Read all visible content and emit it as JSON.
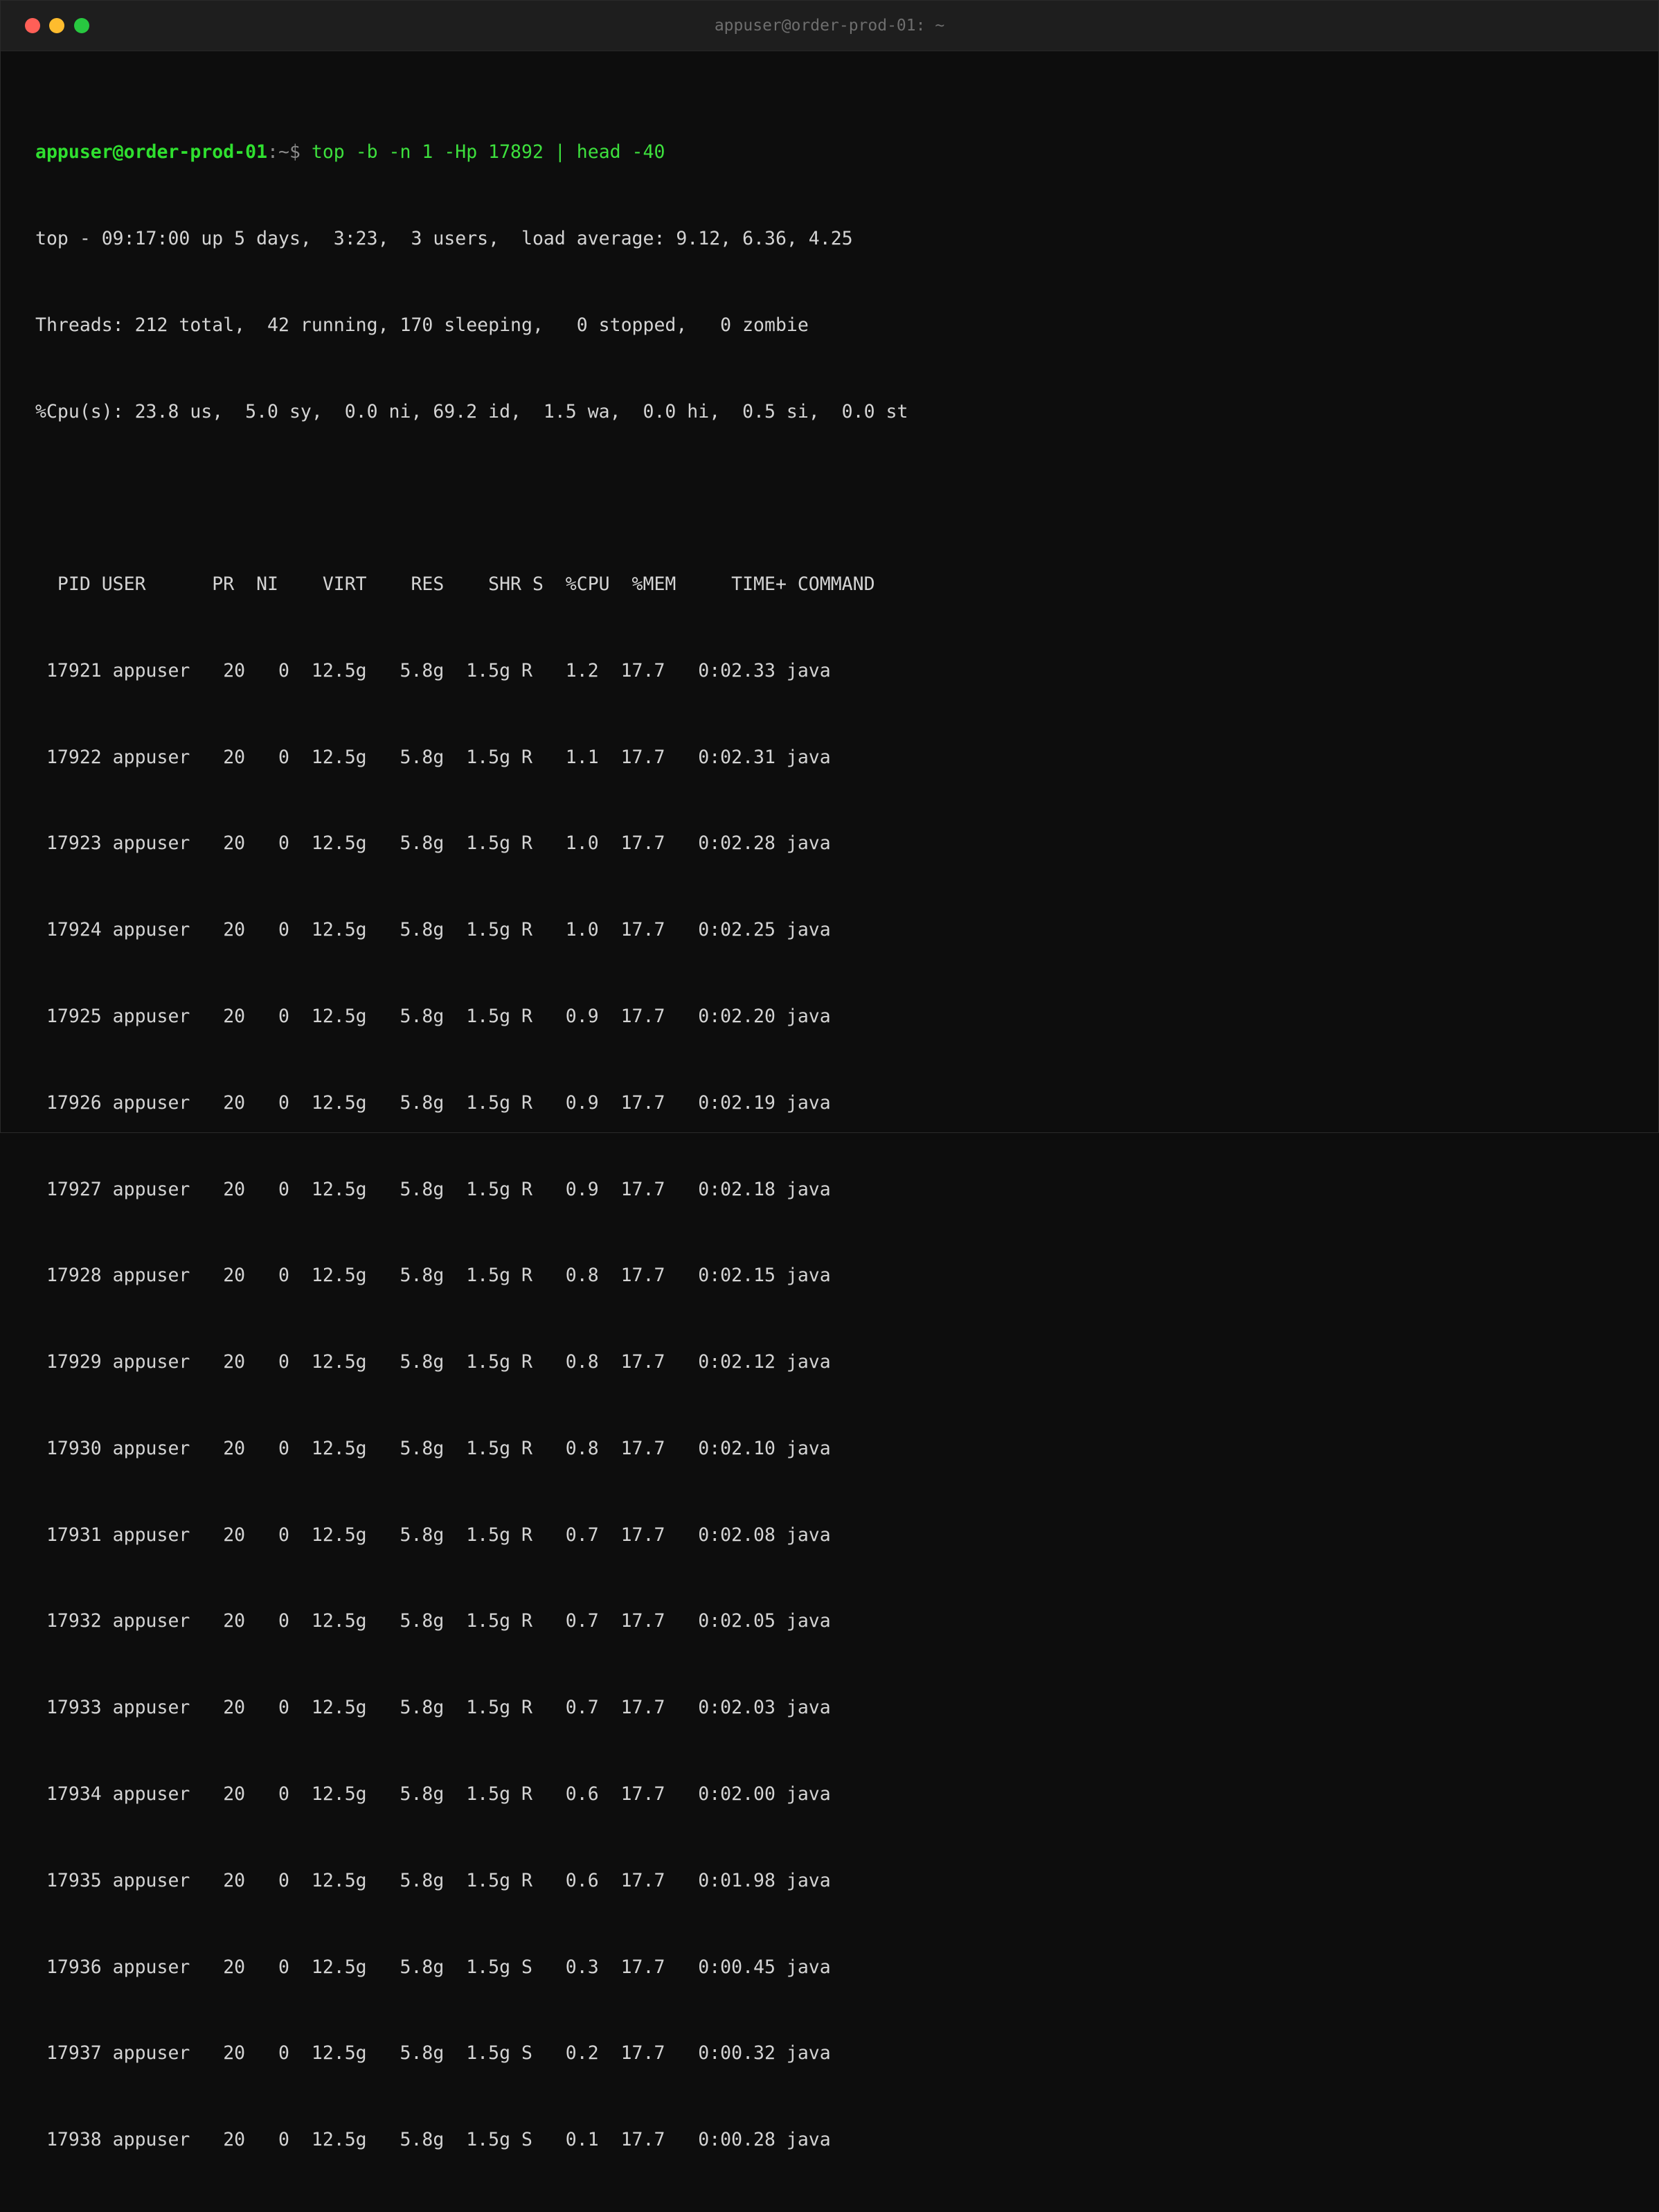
{
  "window": {
    "title": "appuser@order-prod-01: ~"
  },
  "prompt": {
    "user_host": "appuser@order-prod-01",
    "path_symbol": ":~$",
    "command": " top -b -n 1 -Hp 17892 | head -40"
  },
  "summary": [
    "top - 09:17:00 up 5 days,  3:23,  3 users,  load average: 9.12, 6.36, 4.25",
    "Threads: 212 total,  42 running, 170 sleeping,   0 stopped,   0 zombie",
    "%Cpu(s): 23.8 us,  5.0 sy,  0.0 ni, 69.2 id,  1.5 wa,  0.0 hi,  0.5 si,  0.0 st"
  ],
  "table": {
    "header": "  PID USER      PR  NI    VIRT    RES    SHR S  %CPU  %MEM     TIME+ COMMAND",
    "rows": [
      " 17921 appuser   20   0  12.5g   5.8g  1.5g R   1.2  17.7   0:02.33 java",
      " 17922 appuser   20   0  12.5g   5.8g  1.5g R   1.1  17.7   0:02.31 java",
      " 17923 appuser   20   0  12.5g   5.8g  1.5g R   1.0  17.7   0:02.28 java",
      " 17924 appuser   20   0  12.5g   5.8g  1.5g R   1.0  17.7   0:02.25 java",
      " 17925 appuser   20   0  12.5g   5.8g  1.5g R   0.9  17.7   0:02.20 java",
      " 17926 appuser   20   0  12.5g   5.8g  1.5g R   0.9  17.7   0:02.19 java",
      " 17927 appuser   20   0  12.5g   5.8g  1.5g R   0.9  17.7   0:02.18 java",
      " 17928 appuser   20   0  12.5g   5.8g  1.5g R   0.8  17.7   0:02.15 java",
      " 17929 appuser   20   0  12.5g   5.8g  1.5g R   0.8  17.7   0:02.12 java",
      " 17930 appuser   20   0  12.5g   5.8g  1.5g R   0.8  17.7   0:02.10 java",
      " 17931 appuser   20   0  12.5g   5.8g  1.5g R   0.7  17.7   0:02.08 java",
      " 17932 appuser   20   0  12.5g   5.8g  1.5g R   0.7  17.7   0:02.05 java",
      " 17933 appuser   20   0  12.5g   5.8g  1.5g R   0.7  17.7   0:02.03 java",
      " 17934 appuser   20   0  12.5g   5.8g  1.5g R   0.6  17.7   0:02.00 java",
      " 17935 appuser   20   0  12.5g   5.8g  1.5g R   0.6  17.7   0:01.98 java",
      " 17936 appuser   20   0  12.5g   5.8g  1.5g S   0.3  17.7   0:00.45 java",
      " 17937 appuser   20   0  12.5g   5.8g  1.5g S   0.2  17.7   0:00.32 java",
      " 17938 appuser   20   0  12.5g   5.8g  1.5g S   0.1  17.7   0:00.28 java"
    ]
  },
  "colors": {
    "background": "#0d0d0d",
    "titlebar": "#1e1e1e",
    "prompt_green": "#2fe02f",
    "text": "#d4d4d4"
  }
}
